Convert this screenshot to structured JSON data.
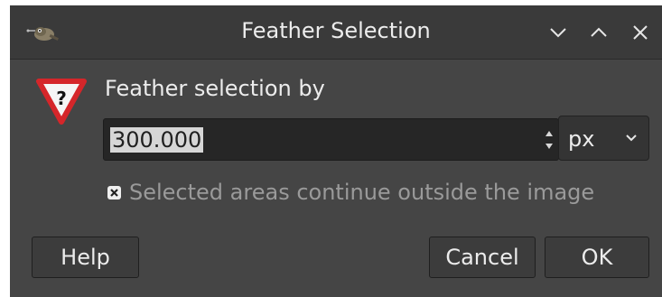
{
  "window": {
    "title": "Feather Selection"
  },
  "dialog": {
    "prompt": "Feather selection by",
    "value": "300.000",
    "unit": "px",
    "checkbox_label": "Selected areas continue outside the image",
    "checkbox_checked": true
  },
  "buttons": {
    "help": "Help",
    "cancel": "Cancel",
    "ok": "OK"
  },
  "icons": {
    "app": "gimp-wilber-icon",
    "warning": "warning-question-icon",
    "minimize": "chevron-down-icon",
    "maximize": "chevron-up-icon",
    "close": "close-icon"
  }
}
